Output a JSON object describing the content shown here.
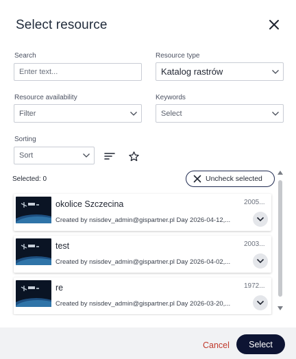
{
  "dialog": {
    "title": "Select resource"
  },
  "filters": {
    "search": {
      "label": "Search",
      "placeholder": "Enter text..."
    },
    "resource_type": {
      "label": "Resource type",
      "value": "Katalog rastrów"
    },
    "availability": {
      "label": "Resource availability",
      "value": "Filter"
    },
    "keywords": {
      "label": "Keywords",
      "value": "Select"
    },
    "sorting": {
      "label": "Sorting",
      "value": "Sort"
    }
  },
  "selection": {
    "count_text": "Selected: 0",
    "uncheck_label": "Uncheck selected"
  },
  "resources": [
    {
      "name": "okolice Szczecina",
      "year": "2005...",
      "meta": "Created by nsisdev_admin@gispartner.pl Day 2026-04-12,..."
    },
    {
      "name": "test",
      "year": "2003...",
      "meta": "Created by nsisdev_admin@gispartner.pl Day 2026-04-02,..."
    },
    {
      "name": "re",
      "year": "1972...",
      "meta": "Created by nsisdev_admin@gispartner.pl Day 2026-03-20,..."
    }
  ],
  "footer": {
    "cancel_label": "Cancel",
    "select_label": "Select"
  },
  "colors": {
    "primary": "#0d1433",
    "cancel": "#c0392b",
    "footer_bg": "#f1f2f4"
  },
  "icons": [
    "close-icon",
    "chevron-down-icon",
    "sort-lines-icon",
    "star-outline-icon",
    "x-icon",
    "satellite-thumbnail"
  ]
}
